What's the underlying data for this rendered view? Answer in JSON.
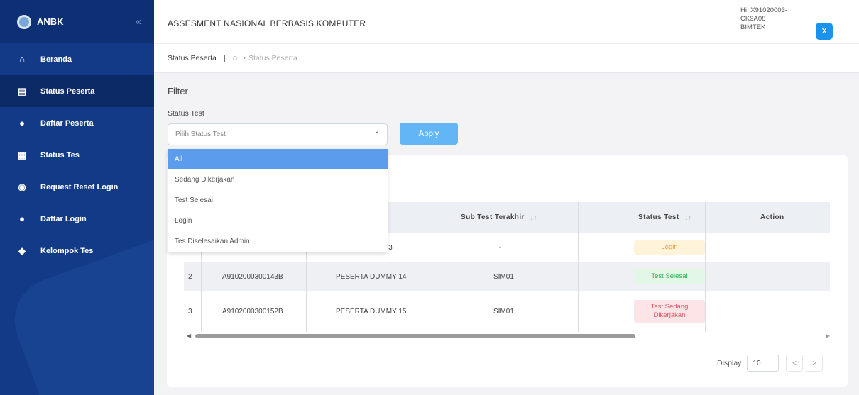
{
  "app": {
    "brand": "ANBK",
    "title": "ASSESMENT NASIONAL BERBASIS KOMPUTER"
  },
  "user": {
    "greeting_line1": "Hi, X91020003-",
    "greeting_line2": "CK9A08",
    "greeting_line3": "BIMTEK",
    "button": "X"
  },
  "breadcrumb": {
    "section": "Status Peserta",
    "separator": "|",
    "dot": "•",
    "current": "Status Peserta"
  },
  "sidebar": {
    "items": [
      {
        "label": "Beranda",
        "icon": "home-icon",
        "glyph": "⌂"
      },
      {
        "label": "Status Peserta",
        "icon": "clipboard-icon",
        "glyph": "▤"
      },
      {
        "label": "Daftar Peserta",
        "icon": "user-icon",
        "glyph": "●"
      },
      {
        "label": "Status Tes",
        "icon": "document-icon",
        "glyph": "▦"
      },
      {
        "label": "Request Reset Login",
        "icon": "reset-icon",
        "glyph": "◉"
      },
      {
        "label": "Daftar Login",
        "icon": "user-login-icon",
        "glyph": "●"
      },
      {
        "label": "Kelompok Tes",
        "icon": "group-icon",
        "glyph": "◆"
      }
    ]
  },
  "filter": {
    "title": "Filter",
    "status_label": "Status Test",
    "placeholder": "Pilih Status Test",
    "apply": "Apply",
    "options": [
      "All",
      "Sedang Dikerjakan",
      "Test Selesai",
      "Login",
      "Tes Diselesaikan Admin"
    ],
    "selected": "All"
  },
  "table": {
    "headers": {
      "sub_test": "Sub Test Terakhir",
      "status": "Status Test",
      "action": "Action"
    },
    "rows": [
      {
        "no": "",
        "nisn": "",
        "name": "MY 13",
        "sub_test": "-",
        "status": "Login"
      },
      {
        "no": "2",
        "nisn": "A9102000300143B",
        "name": "PESERTA DUMMY 14",
        "sub_test": "SIM01",
        "status": "Test Selesai"
      },
      {
        "no": "3",
        "nisn": "A9102000300152B",
        "name": "PESERTA DUMMY 15",
        "sub_test": "SIM01",
        "status": "Test Sedang Dikerjakan"
      }
    ]
  },
  "pagination": {
    "display_label": "Display",
    "page_size": "10"
  }
}
